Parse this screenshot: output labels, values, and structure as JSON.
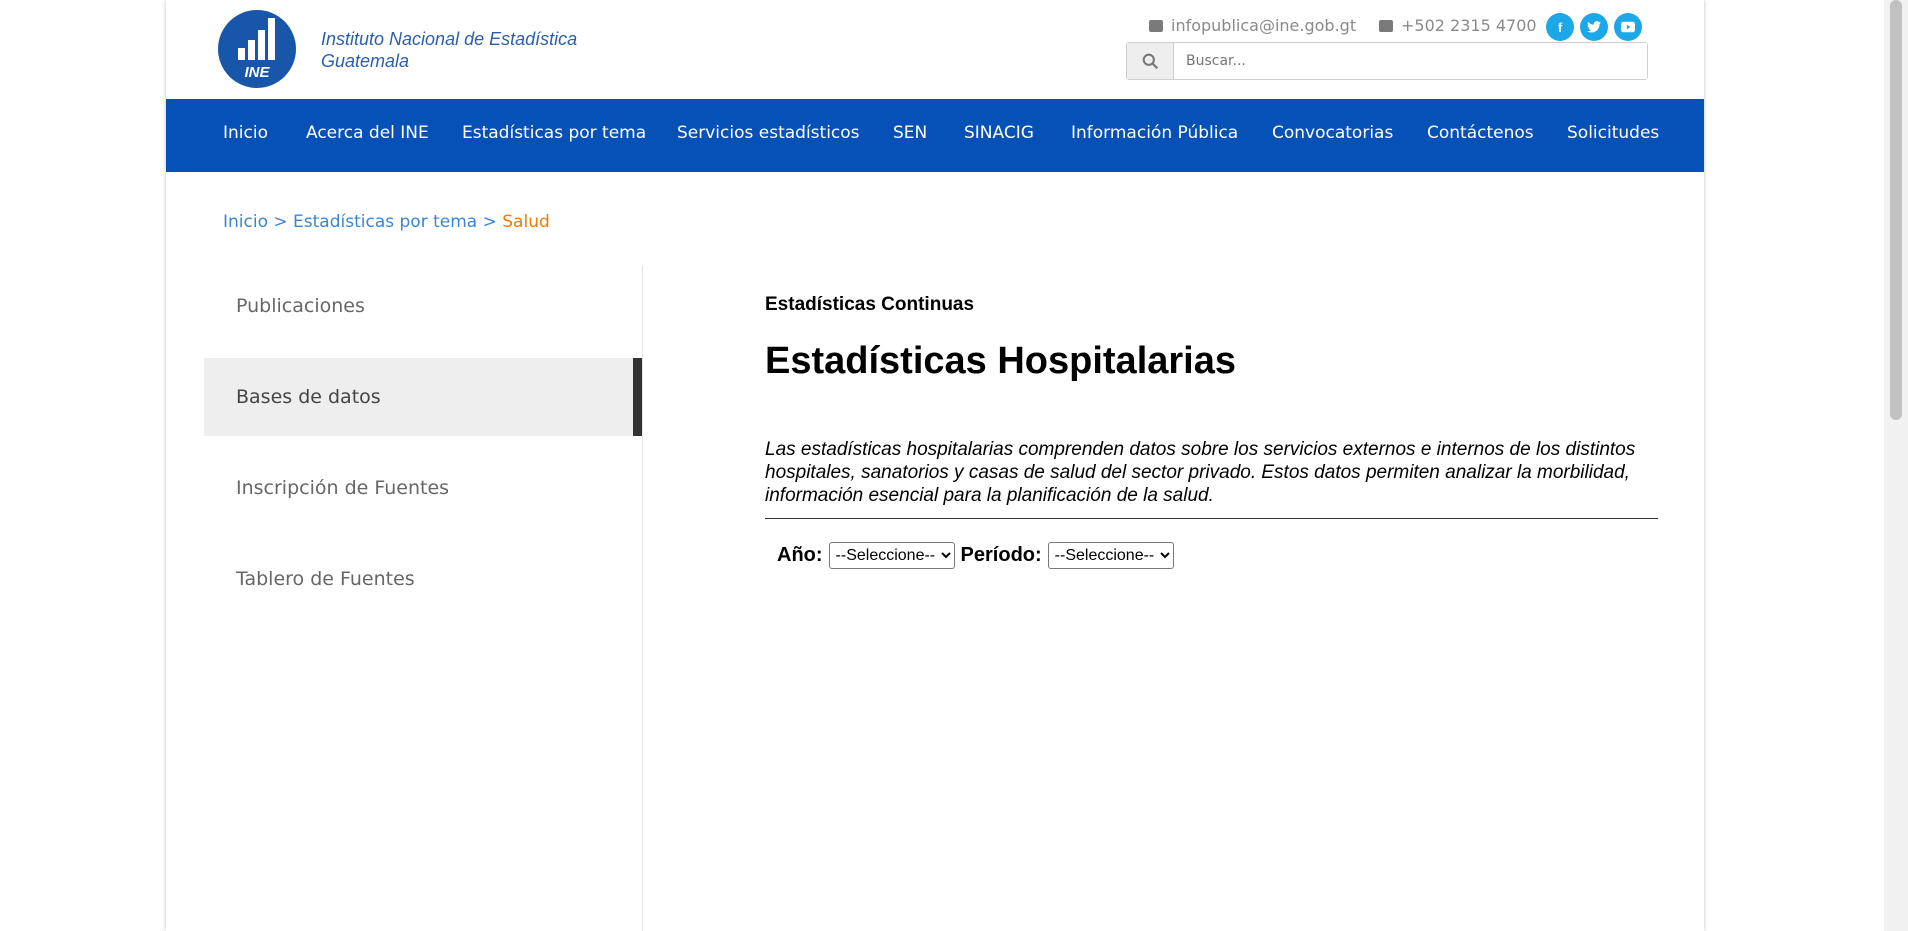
{
  "header": {
    "logo_text": "INE",
    "institution_line1": "Instituto Nacional de Estadística",
    "institution_line2": "Guatemala",
    "email": "infopublica@ine.gob.gt",
    "phone": "+502 2315 4700",
    "social": [
      "f",
      "t",
      "yt"
    ],
    "search_placeholder": "Buscar..."
  },
  "nav": {
    "items": [
      "Inicio",
      "Acerca del INE",
      "Estadísticas por tema",
      "Servicios estadísticos",
      "SEN",
      "SINACIG",
      "Información Pública",
      "Convocatorias",
      "Contáctenos",
      "Solicitudes"
    ],
    "color": "#0651b7"
  },
  "breadcrumb": {
    "home": "Inicio",
    "sep": ">",
    "section": "Estadísticas por tema",
    "current": "Salud"
  },
  "sidebar": {
    "items": [
      "Publicaciones",
      "Bases de datos",
      "Inscripción de Fuentes",
      "Tablero de Fuentes"
    ],
    "active": "Bases de datos"
  },
  "main": {
    "subtitle": "Estadísticas Continuas",
    "title": "Estadísticas Hospitalarias",
    "description": "Las estadísticas hospitalarias comprenden datos sobre los servicios externos e internos de los distintos hospitales, sanatorios y casas de salud del sector privado. Estos datos permiten analizar la morbilidad, información esencial para la planificación de la salud.",
    "year_label": "Año:",
    "year_value": "--Seleccione--",
    "period_label": "Período:",
    "period_value": "--Seleccione--"
  }
}
